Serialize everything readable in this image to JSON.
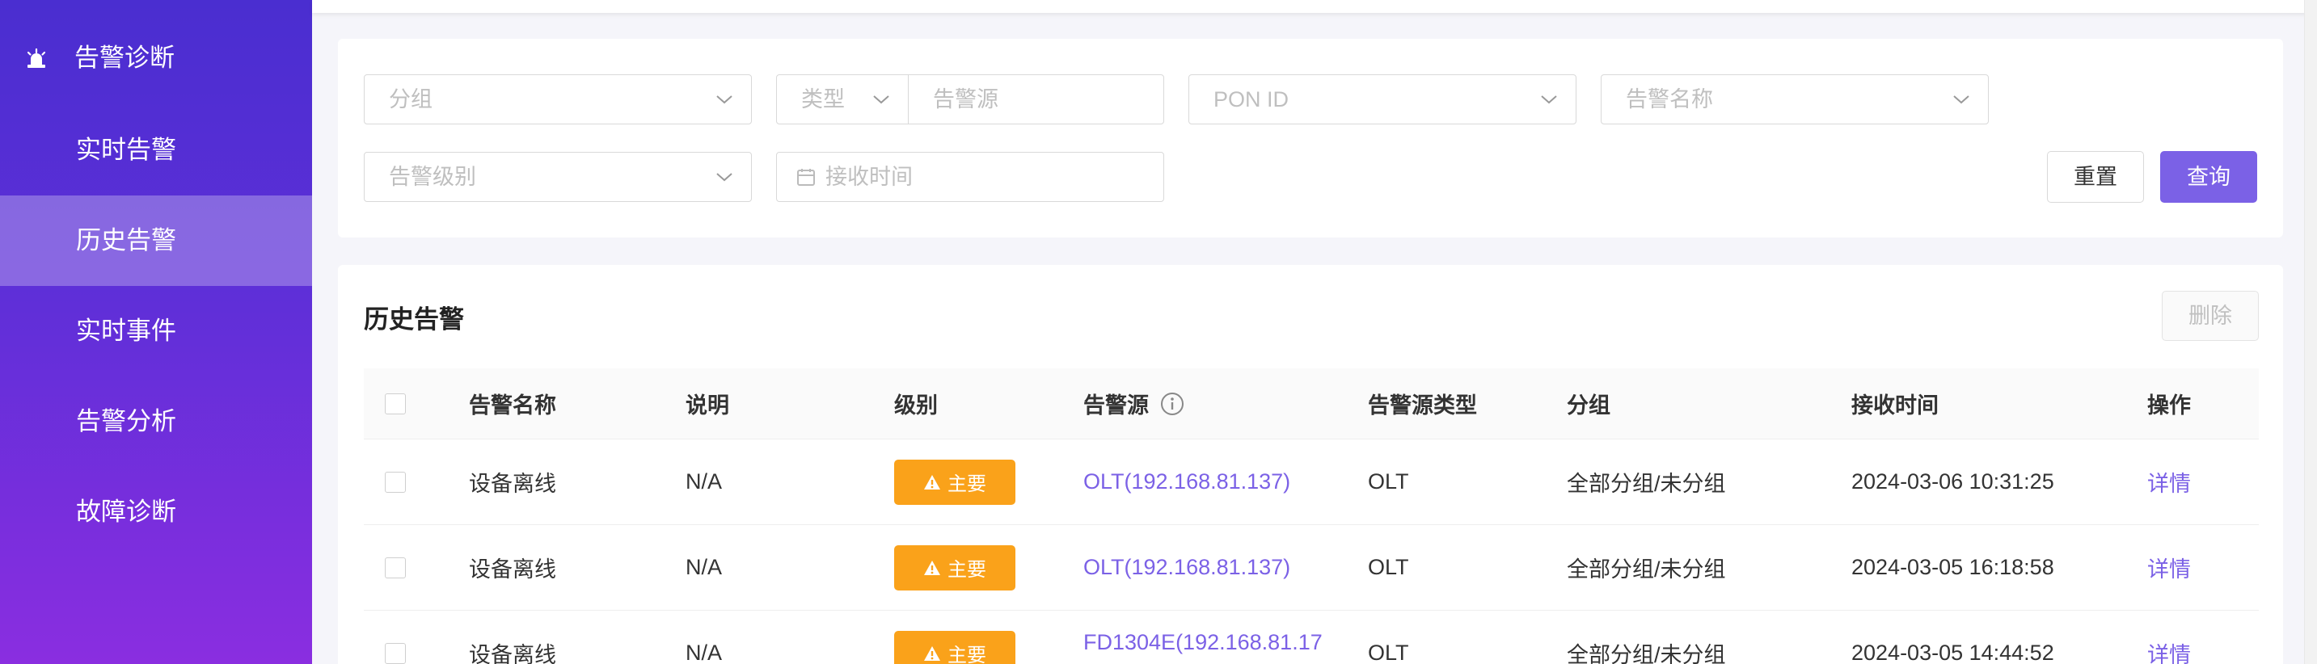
{
  "sidebar": {
    "header_label": "告警诊断",
    "items": [
      {
        "label": "实时告警",
        "active": false
      },
      {
        "label": "历史告警",
        "active": true
      },
      {
        "label": "实时事件",
        "active": false
      },
      {
        "label": "告警分析",
        "active": false
      },
      {
        "label": "故障诊断",
        "active": false
      }
    ]
  },
  "filters": {
    "group_placeholder": "分组",
    "type_placeholder": "类型",
    "source_placeholder": "告警源",
    "pon_placeholder": "PON ID",
    "alarm_name_placeholder": "告警名称",
    "level_placeholder": "告警级别",
    "time_placeholder": "接收时间",
    "reset_label": "重置",
    "query_label": "查询"
  },
  "table": {
    "title": "历史告警",
    "delete_label": "删除",
    "columns": [
      "告警名称",
      "说明",
      "级别",
      "告警源",
      "告警源类型",
      "分组",
      "接收时间",
      "操作"
    ],
    "rows": [
      {
        "name": "设备离线",
        "desc": "N/A",
        "level": "主要",
        "source": "OLT(192.168.81.137)",
        "source_type": "OLT",
        "group": "全部分组/未分组",
        "time": "2024-03-06 10:31:25",
        "action": "详情"
      },
      {
        "name": "设备离线",
        "desc": "N/A",
        "level": "主要",
        "source": "OLT(192.168.81.137)",
        "source_type": "OLT",
        "group": "全部分组/未分组",
        "time": "2024-03-05 16:18:58",
        "action": "详情"
      },
      {
        "name": "设备离线",
        "desc": "N/A",
        "level": "主要",
        "source": "FD1304E(192.168.81.17",
        "source_type": "OLT",
        "group": "全部分组/未分组",
        "time": "2024-03-05 14:44:52",
        "action": "详情"
      }
    ]
  },
  "colors": {
    "accent": "#7b61e6",
    "badge_major": "#faa21a",
    "sidebar_top": "#4a2ed0",
    "sidebar_bottom": "#8a2ee0"
  },
  "icons": {
    "sidebar_header": "alarm-light-icon",
    "chevron": "chevron-down-icon",
    "calendar": "calendar-icon",
    "info": "info-circle-icon",
    "warning": "warning-triangle-icon"
  }
}
